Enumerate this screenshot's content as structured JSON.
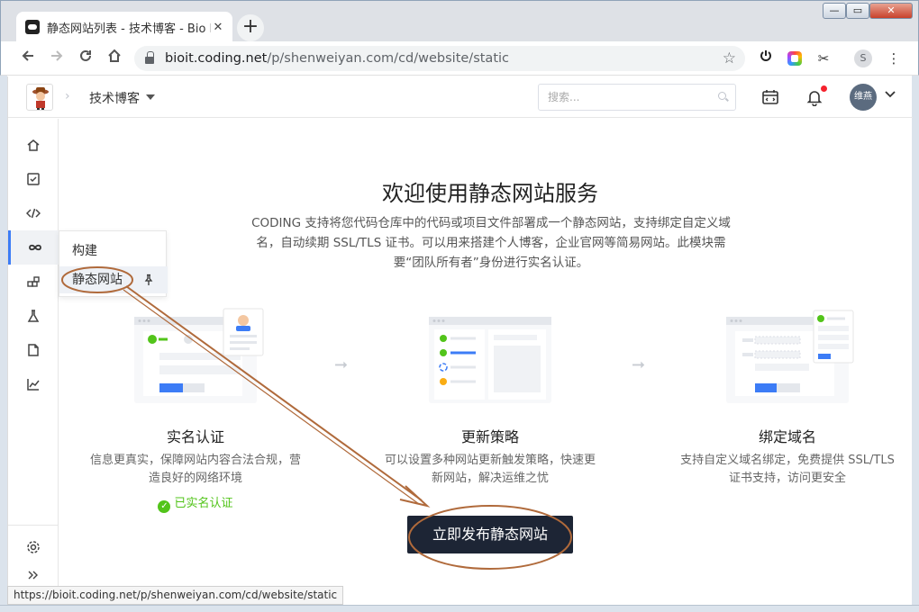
{
  "browser": {
    "tab_title": "静态网站列表 - 技术博客 - Bio IT",
    "tab_close": "✕",
    "new_tab": "+",
    "url_host": "bioit.coding.net",
    "url_path": "/p/shenweiyan.com/cd/website/static",
    "profile_initial": "S",
    "window_controls": {
      "minimize": "—",
      "maximize": "▭",
      "close": "✕"
    }
  },
  "header": {
    "project_name": "技术博客",
    "search_placeholder": "搜索...",
    "user_name": "维燕"
  },
  "flyout": {
    "items": [
      {
        "label": "构建"
      },
      {
        "label": "静态网站"
      }
    ]
  },
  "main": {
    "title": "欢迎使用静态网站服务",
    "description": "CODING 支持将您代码仓库中的代码或项目文件部署成一个静态网站，支持绑定自定义域名，自动续期 SSL/TLS 证书。可以用来搭建个人博客，企业官网等简易网站。此模块需要“团队所有者”身份进行实名认证。",
    "cards": [
      {
        "title": "实名认证",
        "desc": "信息更真实，保障网站内容合法合规，营造良好的网络环境",
        "status": "已实名认证"
      },
      {
        "title": "更新策略",
        "desc": "可以设置多种网站更新触发策略，快速更新网站，解决运维之忧"
      },
      {
        "title": "绑定域名",
        "desc": "支持自定义域名绑定，免费提供 SSL/TLS证书支持，访问更安全"
      }
    ],
    "publish_button": "立即发布静态网站"
  },
  "status_bar_url": "https://bioit.coding.net/p/shenweiyan.com/cd/website/static",
  "colors": {
    "accent": "#3c7cf6",
    "success": "#52c41a",
    "button_dark": "#1d2535",
    "annotation": "#b06a3b"
  }
}
